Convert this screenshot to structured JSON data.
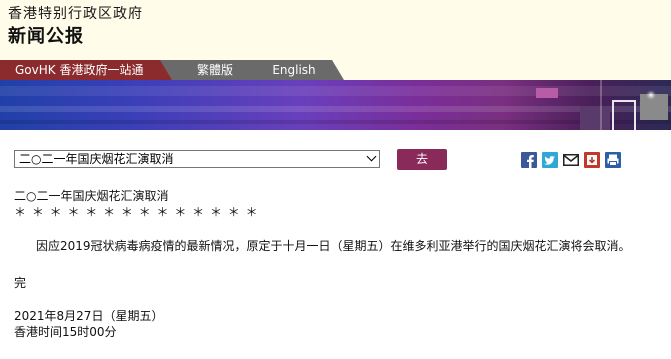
{
  "header": {
    "gov_name": "香港特别行政区政府",
    "section_title": "新闻公报"
  },
  "nav": {
    "gov_portal": "GovHK 香港政府一站通",
    "traditional": "繁體版",
    "english": "English"
  },
  "controls": {
    "selected_headline": "二○二一年国庆烟花汇演取消",
    "go_label": "去"
  },
  "share": {
    "icons": [
      "facebook-icon",
      "twitter-icon",
      "email-icon",
      "mobile-icon",
      "print-icon"
    ],
    "colors": {
      "facebook": "#3b5998",
      "twitter": "#2fa8d8",
      "email": "#222222",
      "mobile": "#c0392b",
      "print": "#2e5ea8"
    }
  },
  "article": {
    "title": "二○二一年国庆烟花汇演取消",
    "stars": "＊ ＊ ＊ ＊ ＊ ＊ ＊ ＊ ＊ ＊ ＊ ＊ ＊ ＊",
    "body": "因应2019冠状病毒病疫情的最新情况，原定于十月一日（星期五）在维多利亚港举行的国庆烟花汇演将会取消。",
    "end_mark": "完",
    "date": "2021年8月27日（星期五）",
    "time": "香港时间15时00分"
  },
  "colors": {
    "header_bg": "#fffde9",
    "gov_tab": "#8c2b2e",
    "lang_tab": "#6a6a6a",
    "go_button": "#8a2a5a"
  }
}
